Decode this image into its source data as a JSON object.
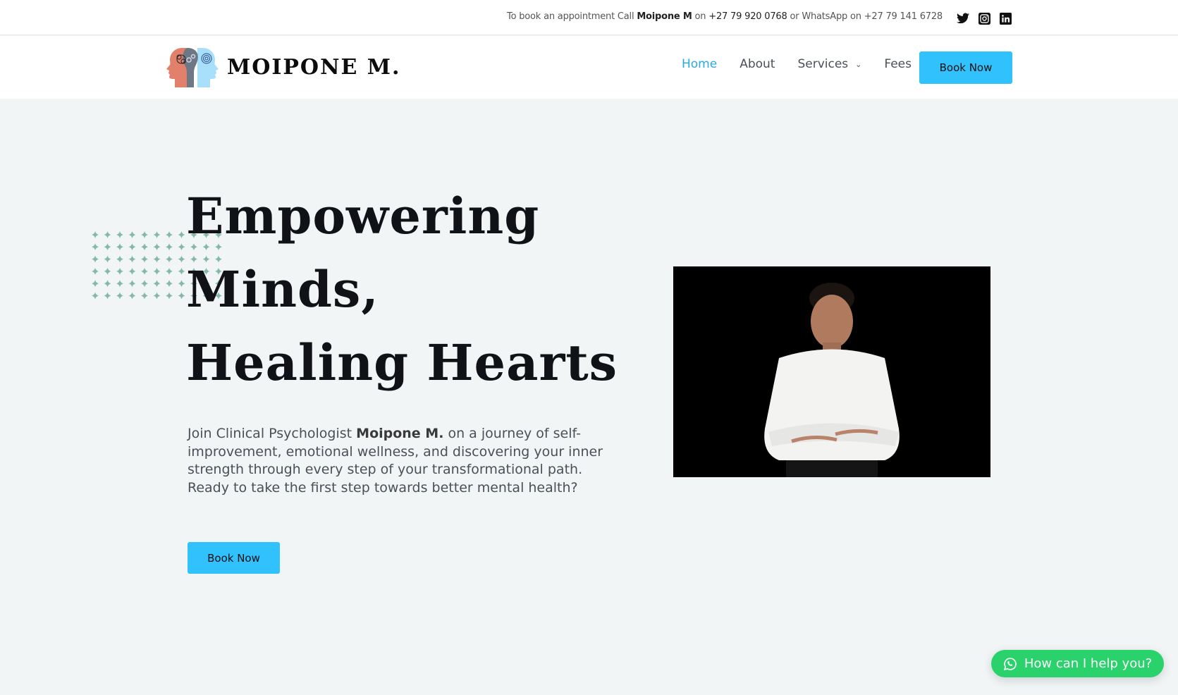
{
  "topbar": {
    "prefix": "To book an appointment Call ",
    "name": "Moipone M",
    "on1": " on ",
    "phone": "+27 79 920 0768",
    "or_whatsapp": " or WhatsApp on ",
    "whatsapp_number": "+27 79 141 6728",
    "social": [
      "twitter-icon",
      "instagram-icon",
      "linkedin-icon"
    ]
  },
  "header": {
    "logo_text": "MOIPONE M.",
    "nav": [
      {
        "label": "Home",
        "active": true
      },
      {
        "label": "About"
      },
      {
        "label": "Services",
        "dropdown": true
      },
      {
        "label": "Fees"
      }
    ],
    "book_label": "Book Now"
  },
  "hero": {
    "title_lines": [
      "Empowering",
      "Minds,",
      "Healing Hearts"
    ],
    "text_before": "Join Clinical Psychologist ",
    "text_bold": "Moipone M.",
    "text_after": " on a journey of self-improvement, emotional wellness, and discovering your inner strength through every step of your transformational path. Ready to take the first step towards better mental health?",
    "button_label": "Book Now"
  },
  "whatsapp": {
    "label": "How can I help you?"
  },
  "colors": {
    "accent": "#31c1fd",
    "nav_active": "#2aa8e0",
    "whatsapp": "#2ad26c",
    "dots": "#86b8a8",
    "background": "#f1f5f6"
  }
}
